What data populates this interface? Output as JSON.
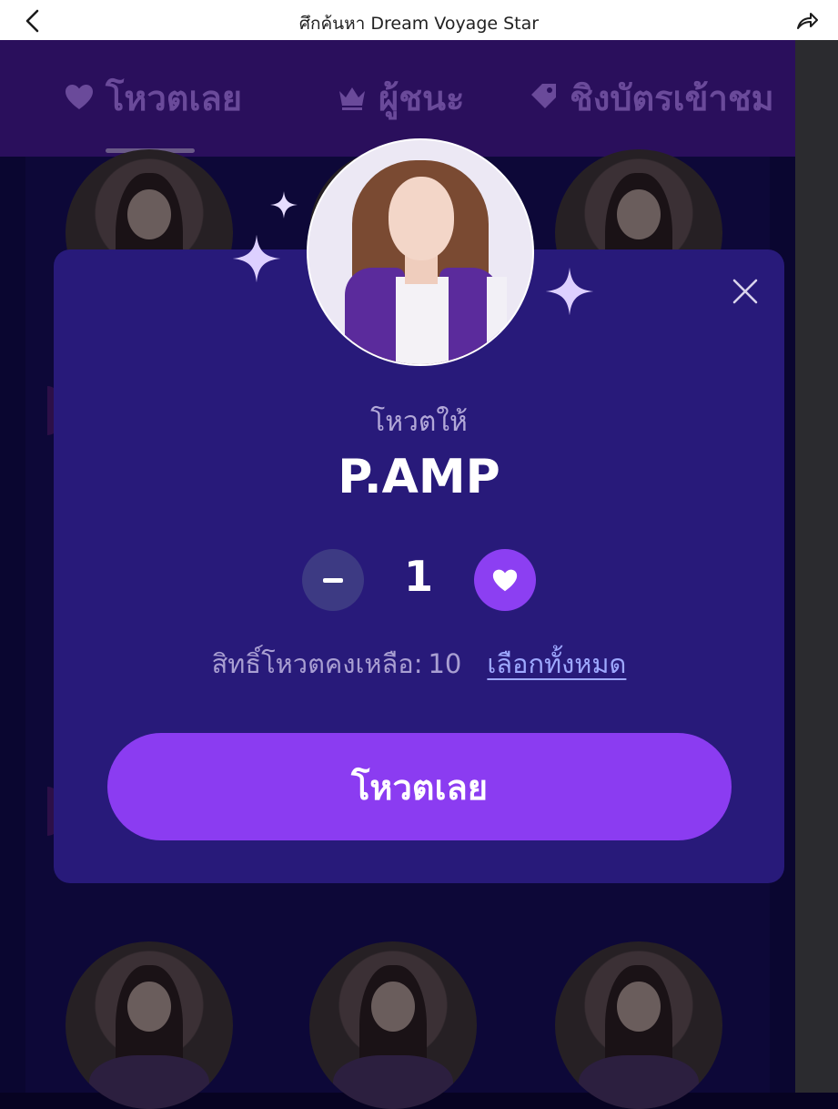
{
  "topbar": {
    "title": "ศึกค้นหา Dream Voyage Star",
    "back_icon": "chevron-left-icon",
    "share_icon": "share-icon"
  },
  "tabs": [
    {
      "label": "โหวตเลย",
      "icon": "heart-icon",
      "active": true
    },
    {
      "label": "ผู้ชนะ",
      "icon": "crown-icon",
      "active": false
    },
    {
      "label": "ชิงบัตรเข้าชม",
      "icon": "ticket-icon",
      "active": false
    }
  ],
  "modal": {
    "vote_for_label": "โหวตให้",
    "candidate_name": "P.AMP",
    "vote_count": "1",
    "remaining_label": "สิทธิ์โหวตคงเหลือ:",
    "remaining_value": "10",
    "select_all_label": "เลือกทั้งหมด",
    "submit_label": "โหวตเลย",
    "close_icon": "close-icon"
  },
  "colors": {
    "modal_bg": "#281a7a",
    "accent_purple": "#8b3cf1",
    "minus_button": "#3d3a83",
    "link_blue": "#9ea8ff",
    "tab_bar": "#2a0f5c"
  }
}
